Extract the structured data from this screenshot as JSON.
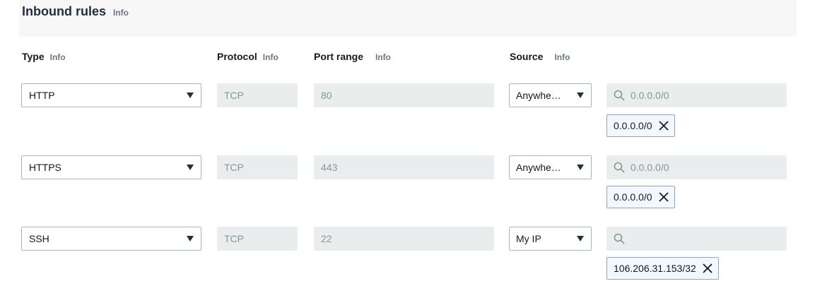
{
  "section": {
    "title": "Inbound rules",
    "info": "Info"
  },
  "columns": {
    "type": "Type",
    "protocol": "Protocol",
    "port_range": "Port range",
    "source": "Source",
    "info": "Info"
  },
  "rules": [
    {
      "type": "HTTP",
      "protocol": "TCP",
      "port_range": "80",
      "source": "Anywhe…",
      "cidr_placeholder": "0.0.0.0/0",
      "cidr_token": "0.0.0.0/0"
    },
    {
      "type": "HTTPS",
      "protocol": "TCP",
      "port_range": "443",
      "source": "Anywhe…",
      "cidr_placeholder": "0.0.0.0/0",
      "cidr_token": "0.0.0.0/0"
    },
    {
      "type": "SSH",
      "protocol": "TCP",
      "port_range": "22",
      "source": "My IP",
      "cidr_placeholder": "",
      "cidr_token": "106.206.31.153/32"
    }
  ],
  "icons": {
    "search": "search-icon",
    "remove": "close-icon",
    "dropdown": "caret-down-icon"
  },
  "colors": {
    "info_link": "#6b7785",
    "token_bg": "#f2f8fd",
    "disabled_bg": "#eaeded"
  }
}
